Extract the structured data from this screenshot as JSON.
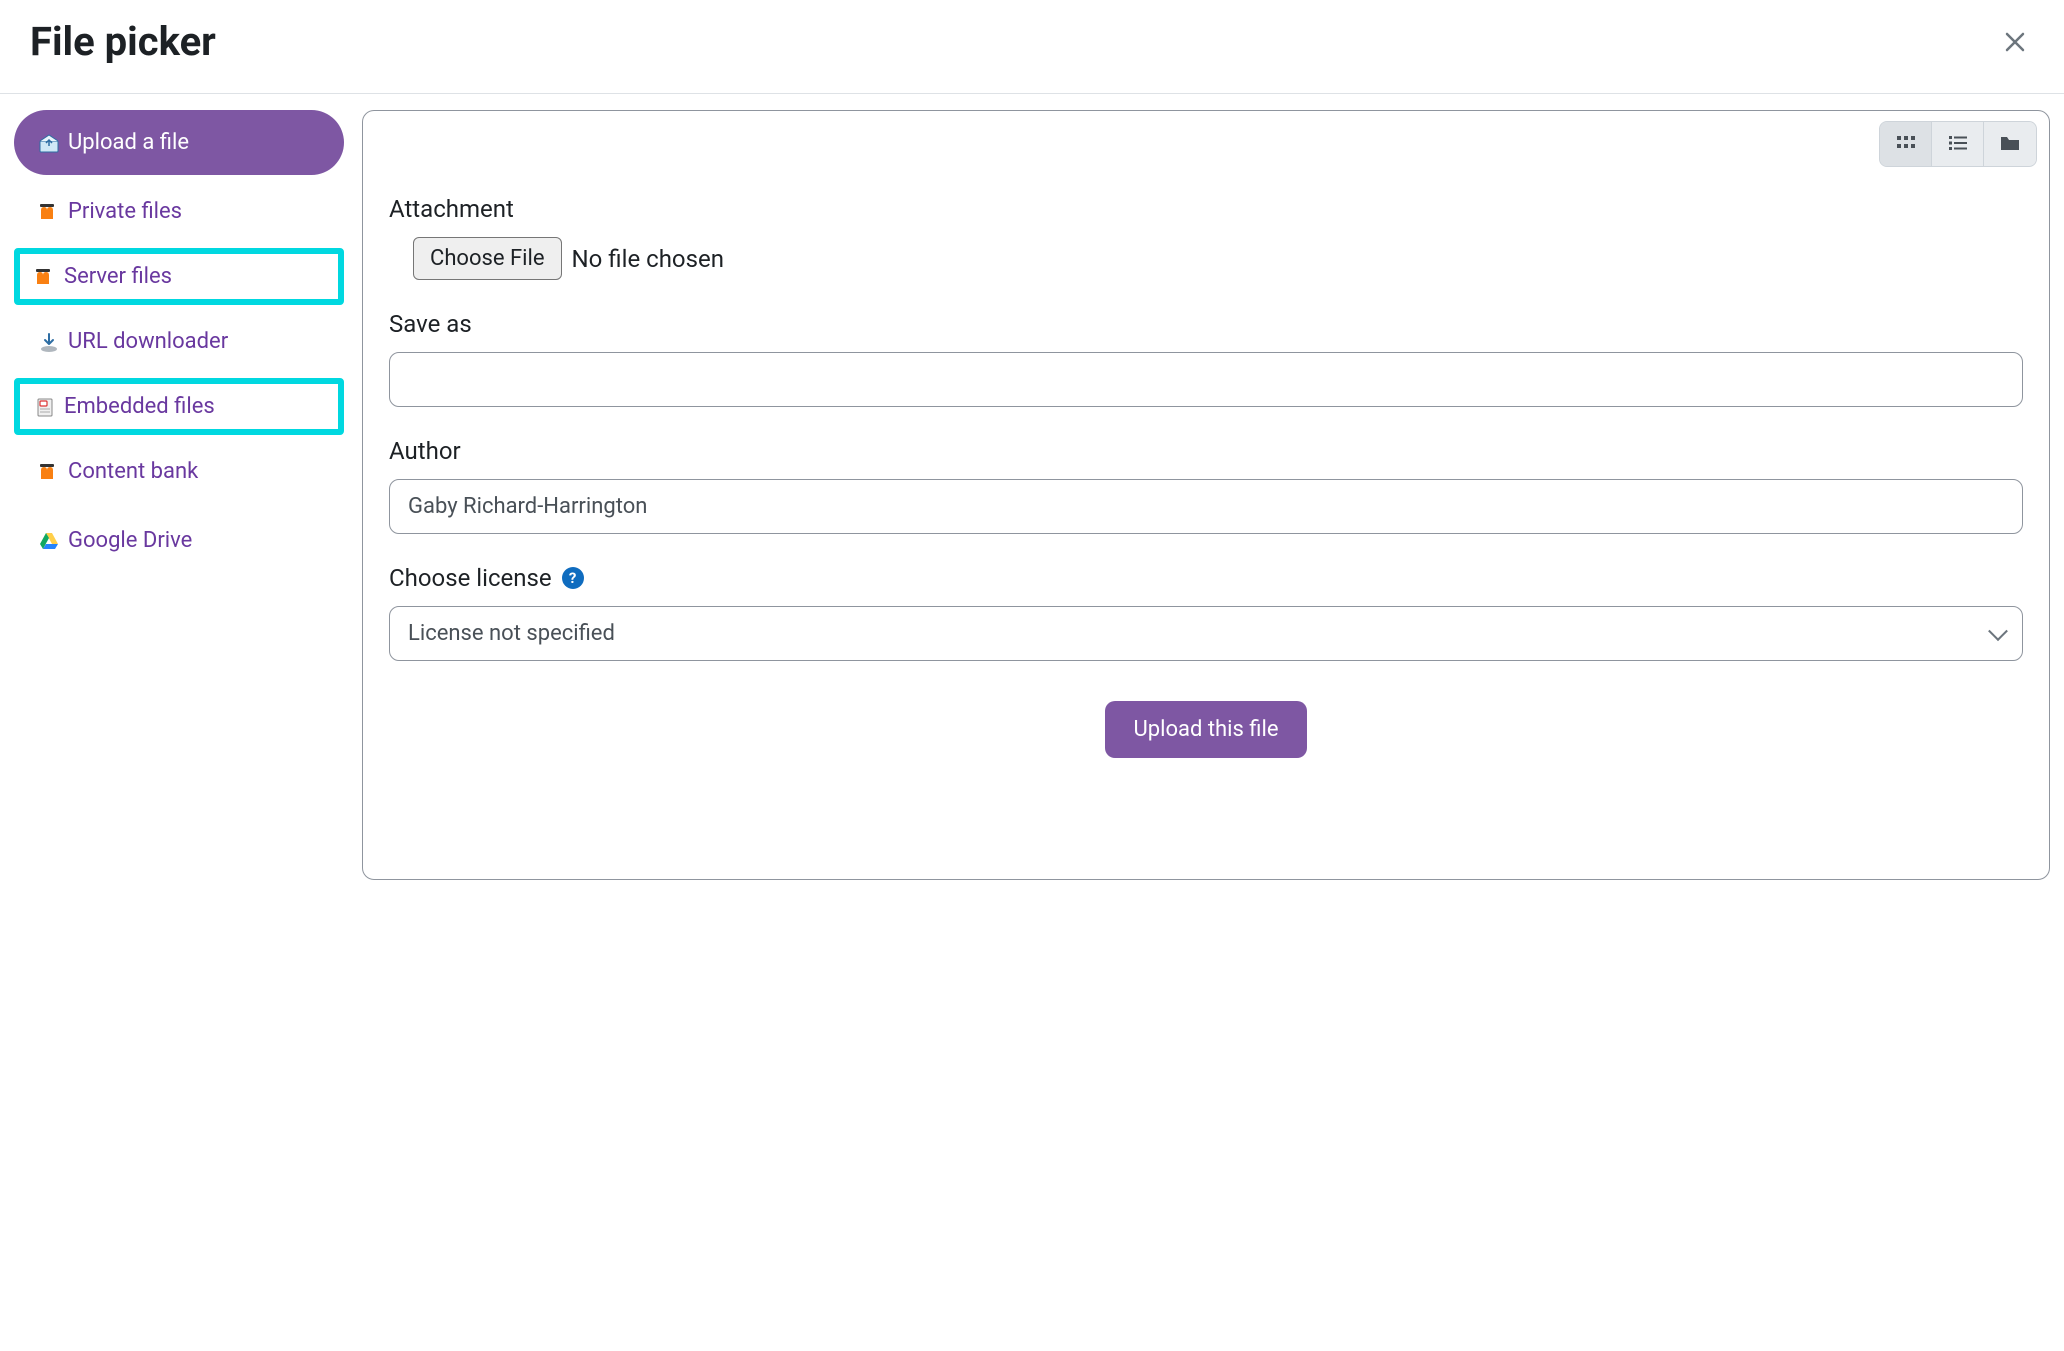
{
  "header": {
    "title": "File picker"
  },
  "sidebar": {
    "items": [
      {
        "label": "Upload a file",
        "icon": "upload",
        "active": true,
        "highlighted": false
      },
      {
        "label": "Private files",
        "icon": "moodle",
        "active": false,
        "highlighted": false
      },
      {
        "label": "Server files",
        "icon": "moodle",
        "active": false,
        "highlighted": true
      },
      {
        "label": "URL downloader",
        "icon": "download",
        "active": false,
        "highlighted": false
      },
      {
        "label": "Embedded files",
        "icon": "embedded",
        "active": false,
        "highlighted": true
      },
      {
        "label": "Content bank",
        "icon": "moodle",
        "active": false,
        "highlighted": false
      },
      {
        "label": "Google Drive",
        "icon": "gdrive",
        "active": false,
        "highlighted": false
      }
    ]
  },
  "main": {
    "form": {
      "attachment_label": "Attachment",
      "choose_file_label": "Choose File",
      "file_status": "No file chosen",
      "save_as_label": "Save as",
      "save_as_value": "",
      "author_label": "Author",
      "author_value": "Gaby Richard-Harrington",
      "license_label": "Choose license",
      "license_selected": "License not specified",
      "submit_label": "Upload this file"
    }
  }
}
